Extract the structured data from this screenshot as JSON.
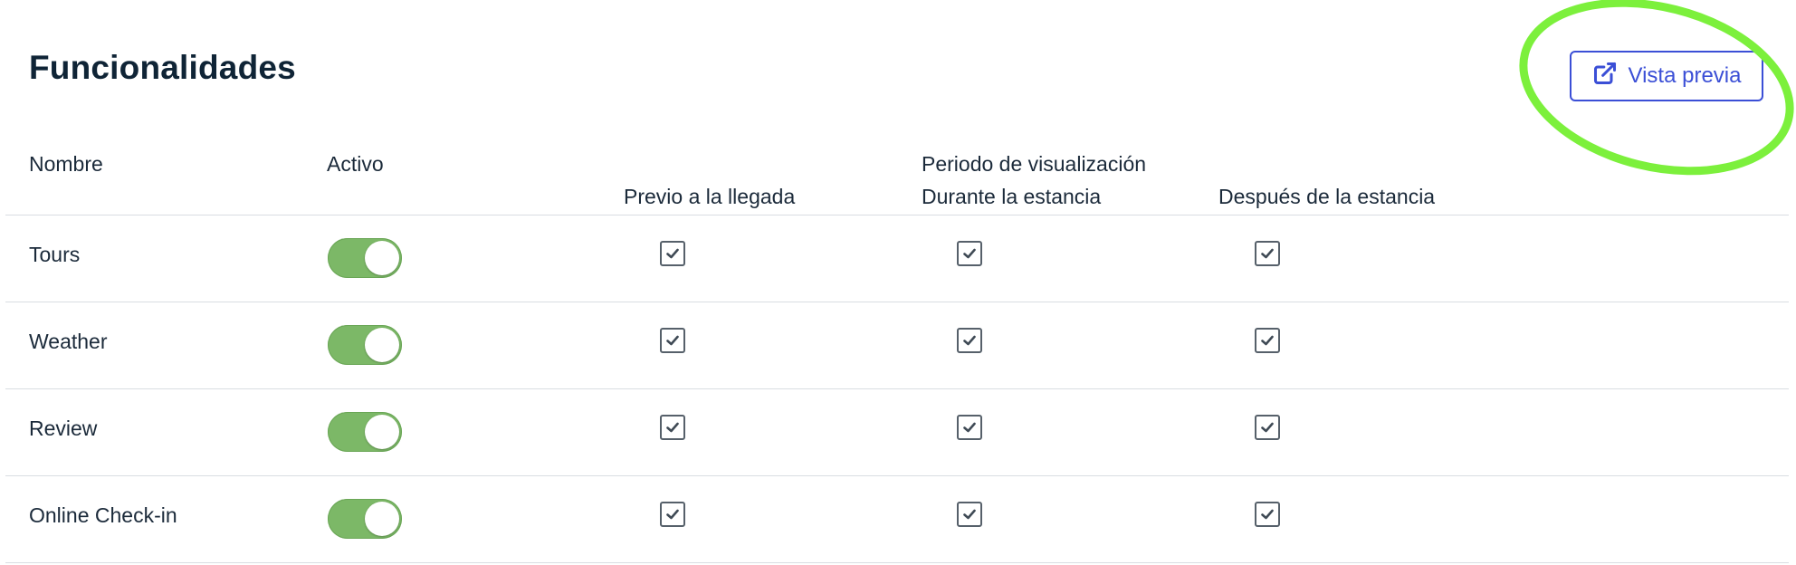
{
  "header": {
    "title": "Funcionalidades",
    "preview_button": {
      "label": "Vista previa",
      "icon": "external-link-icon"
    },
    "accent_color": "#3b4fd6",
    "highlight_color": "#7cf03c"
  },
  "table": {
    "columns": {
      "name": "Nombre",
      "active": "Activo",
      "period_group": "Periodo de visualización",
      "before": "Previo a la llegada",
      "during": "Durante la estancia",
      "after": "Después de la estancia"
    },
    "rows": [
      {
        "name": "Tours",
        "active": true,
        "before": true,
        "during": true,
        "after": true
      },
      {
        "name": "Weather",
        "active": true,
        "before": true,
        "during": true,
        "after": true
      },
      {
        "name": "Review",
        "active": true,
        "before": true,
        "during": true,
        "after": true
      },
      {
        "name": "Online Check-in",
        "active": true,
        "before": true,
        "during": true,
        "after": true
      }
    ],
    "toggle_on_color": "#7cb867"
  }
}
